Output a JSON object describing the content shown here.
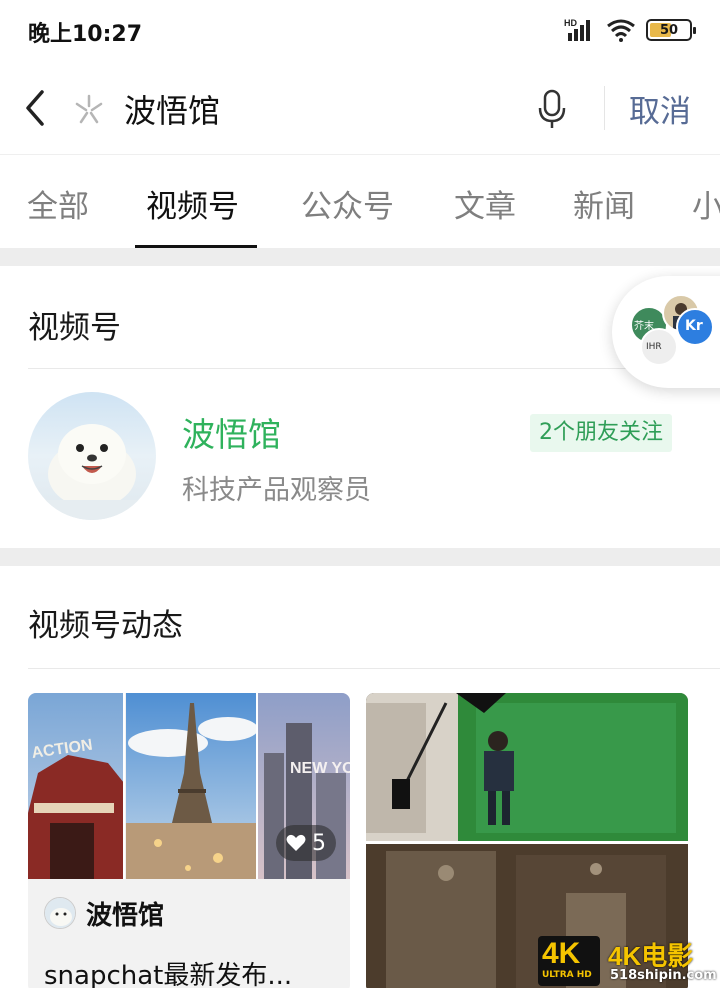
{
  "status_bar": {
    "time": "晚上10:27",
    "network_label": "HD",
    "battery": "50"
  },
  "search": {
    "query": "波悟馆",
    "cancel_label": "取消"
  },
  "tabs": [
    {
      "label": "全部",
      "active": false
    },
    {
      "label": "视频号",
      "active": true
    },
    {
      "label": "公众号",
      "active": false
    },
    {
      "label": "文章",
      "active": false
    },
    {
      "label": "新闻",
      "active": false
    },
    {
      "label": "小",
      "active": false
    }
  ],
  "channels_section": {
    "title": "视频号",
    "account": {
      "name": "波悟馆",
      "description": "科技产品观察员",
      "friend_badge": "2个朋友关注"
    }
  },
  "floating_bubble": {
    "avatars": [
      "芥末",
      "Kr",
      "IHR"
    ]
  },
  "posts_section": {
    "title": "视频号动态",
    "posts": [
      {
        "author": "波悟馆",
        "text": "snapchat最新发布...",
        "likes": "5",
        "image_captions": [
          "ACTION",
          "NEW YORK CITY"
        ]
      },
      {
        "author": "",
        "text": "",
        "likes": ""
      }
    ]
  },
  "watermark": {
    "badge": "4K",
    "badge_sub": "ULTRA HD",
    "brand": "4K电影",
    "site": "518shipin.com"
  },
  "colors": {
    "accent_green": "#2fb25c",
    "link_blue": "#576b95",
    "badge_bg": "#e9f8ee"
  }
}
